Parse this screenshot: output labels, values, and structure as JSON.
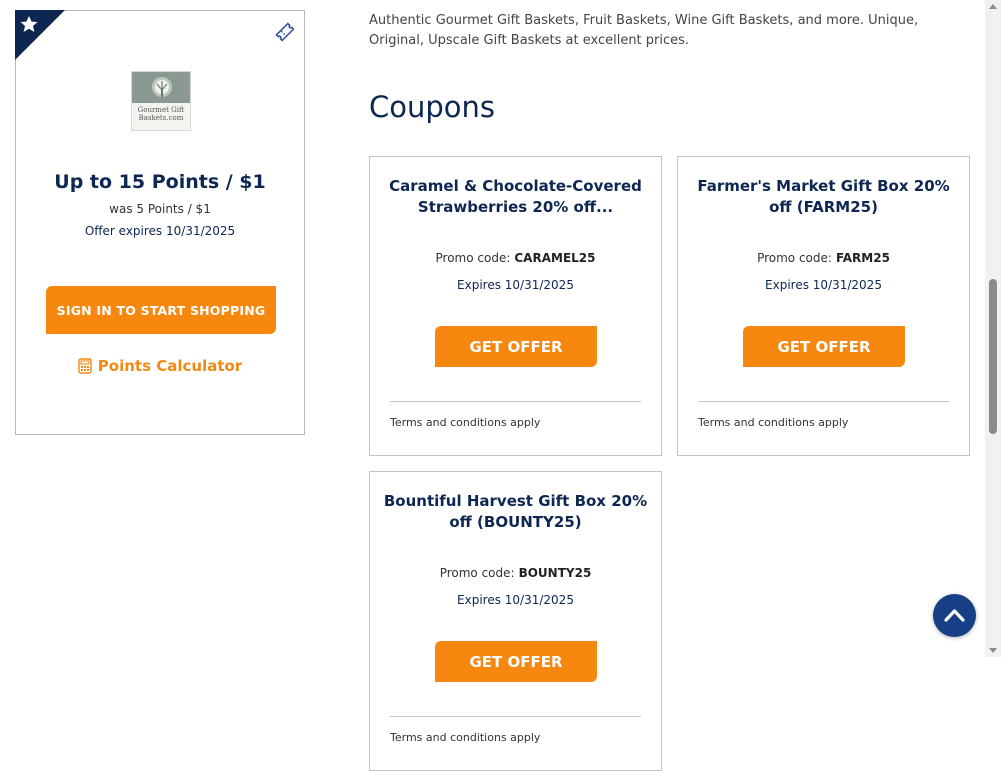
{
  "merchant": {
    "logo_text": "Gourmet Gift Baskets.com",
    "points_title": "Up to 15 Points / $1",
    "was_points": "was 5 Points / $1",
    "offer_expires": "Offer expires 10/31/2025",
    "signin_button": "SIGN IN TO START SHOPPING",
    "points_calculator": "Points Calculator",
    "icons": [
      "star-icon",
      "ticket-icon",
      "calculator-icon"
    ]
  },
  "description": "Authentic Gourmet Gift Baskets, Fruit Baskets, Wine Gift Baskets, and more. Unique, Original, Upscale Gift Baskets at excellent prices.",
  "section_title": "Coupons",
  "coupons": [
    {
      "title": "Caramel & Chocolate-Covered Strawberries 20% off...",
      "promo_label": "Promo code:",
      "code": "CARAMEL25",
      "expires": "Expires 10/31/2025",
      "button": "GET OFFER",
      "terms": "Terms and conditions apply"
    },
    {
      "title": "Farmer's Market Gift Box 20% off (FARM25)",
      "promo_label": "Promo code:",
      "code": "FARM25",
      "expires": "Expires 10/31/2025",
      "button": "GET OFFER",
      "terms": "Terms and conditions apply"
    },
    {
      "title": "Bountiful Harvest Gift Box 20% off (BOUNTY25)",
      "promo_label": "Promo code:",
      "code": "BOUNTY25",
      "expires": "Expires 10/31/2025",
      "button": "GET OFFER",
      "terms": "Terms and conditions apply"
    }
  ],
  "colors": {
    "navy": "#0d2752",
    "orange": "#f6870f",
    "back_to_top": "#163f86"
  }
}
